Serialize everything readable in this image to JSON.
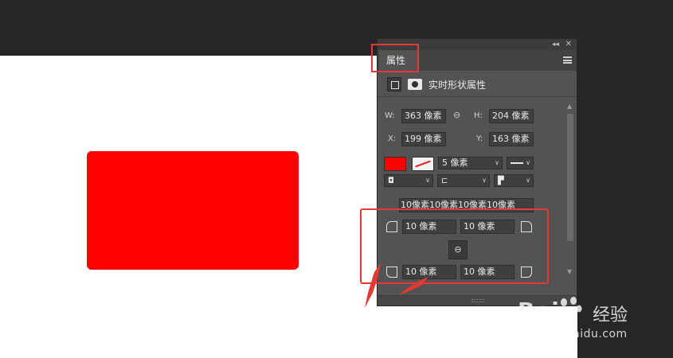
{
  "canvas": {
    "shape_color": "#ff0000"
  },
  "panel": {
    "tab_label": "属性",
    "header_label": "实时形状属性",
    "transform": {
      "w_label": "W:",
      "w_value": "363 像素",
      "h_label": "H:",
      "h_value": "204 像素",
      "x_label": "X:",
      "x_value": "199 像素",
      "y_label": "Y:",
      "y_value": "163 像素"
    },
    "appearance": {
      "fill_color": "#ff0000",
      "stroke_width": "5 像素"
    },
    "corners": {
      "summary": "10像素10像素10像素10像素",
      "top_left": "10 像素",
      "top_right": "10 像素",
      "bottom_left": "10 像素",
      "bottom_right": "10 像素"
    }
  },
  "annotation": {
    "highlight_color": "#e53935"
  },
  "watermark": {
    "brand": "Bai",
    "brand_sub": "经验",
    "url": "jingyan.baidu.com"
  }
}
